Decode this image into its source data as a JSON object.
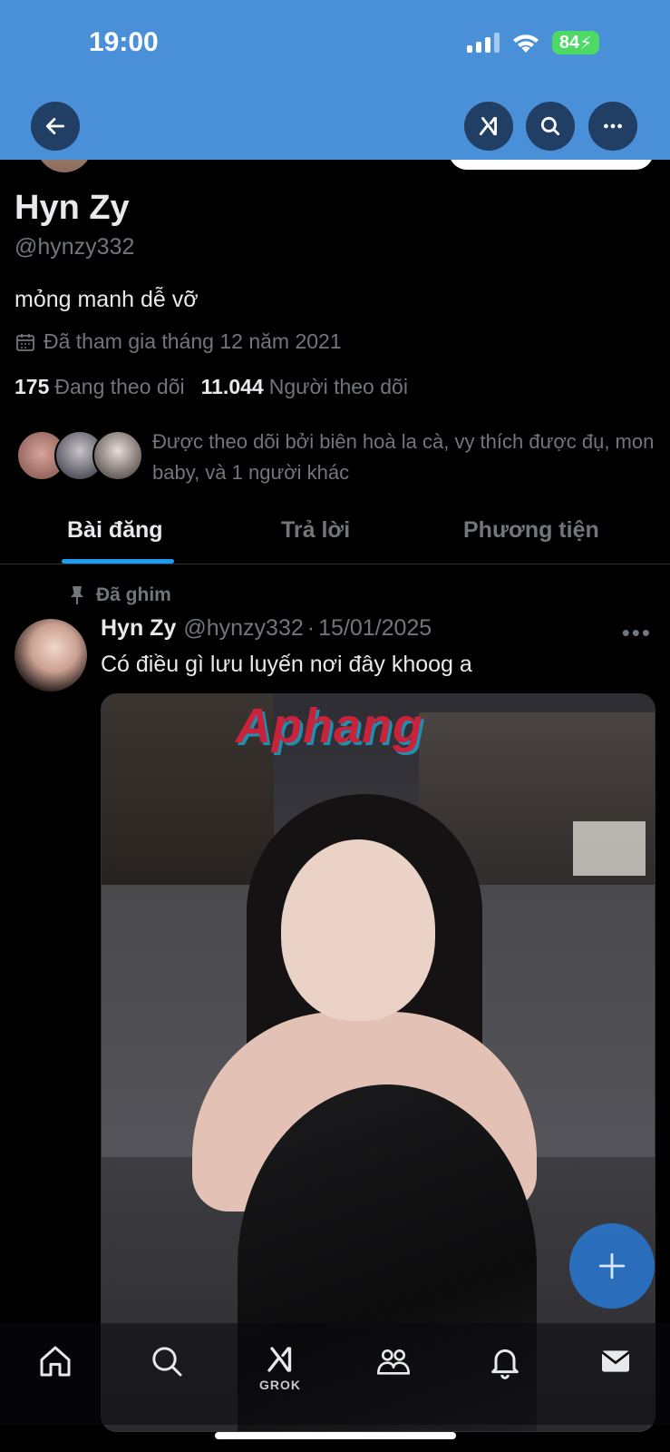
{
  "status_bar": {
    "time": "19:00",
    "battery": "84"
  },
  "profile": {
    "name": "Hyn Zy",
    "handle": "@hynzy332",
    "bio": "mỏng manh dễ vỡ",
    "joined": "Đã tham gia tháng 12 năm 2021",
    "following_count": "175",
    "following_label": "Đang theo dõi",
    "followers_count": "11.044",
    "followers_label": "Người theo dõi",
    "followed_by": "Được theo dõi bởi biên hoà la cà, vy thích được đụ, mon baby, và 1 người khác"
  },
  "tabs": [
    {
      "label": "Bài đăng"
    },
    {
      "label": "Trả lời"
    },
    {
      "label": "Phương tiện"
    }
  ],
  "pinned_post": {
    "pinned_label": "Đã ghim",
    "author_name": "Hyn Zy",
    "author_handle": "@hynzy332",
    "separator": "·",
    "date": "15/01/2025",
    "text": "Có điều gì lưu luyến nơi đây khoog a",
    "image_watermark": "Aphang"
  },
  "bottom_nav": {
    "grok_label": "GROK"
  },
  "icons": {
    "back": "arrow-left-icon",
    "grok": "grok-icon",
    "search": "search-icon",
    "more": "more-icon",
    "calendar": "calendar-icon",
    "pin": "pin-icon",
    "compose": "plus-icon",
    "home": "home-icon",
    "communities": "people-icon",
    "notifications": "bell-icon",
    "messages": "mail-icon"
  },
  "colors": {
    "header_bg": "#4a90d9",
    "accent": "#1d9bf0",
    "muted": "#71767b",
    "battery": "#4cd964"
  }
}
